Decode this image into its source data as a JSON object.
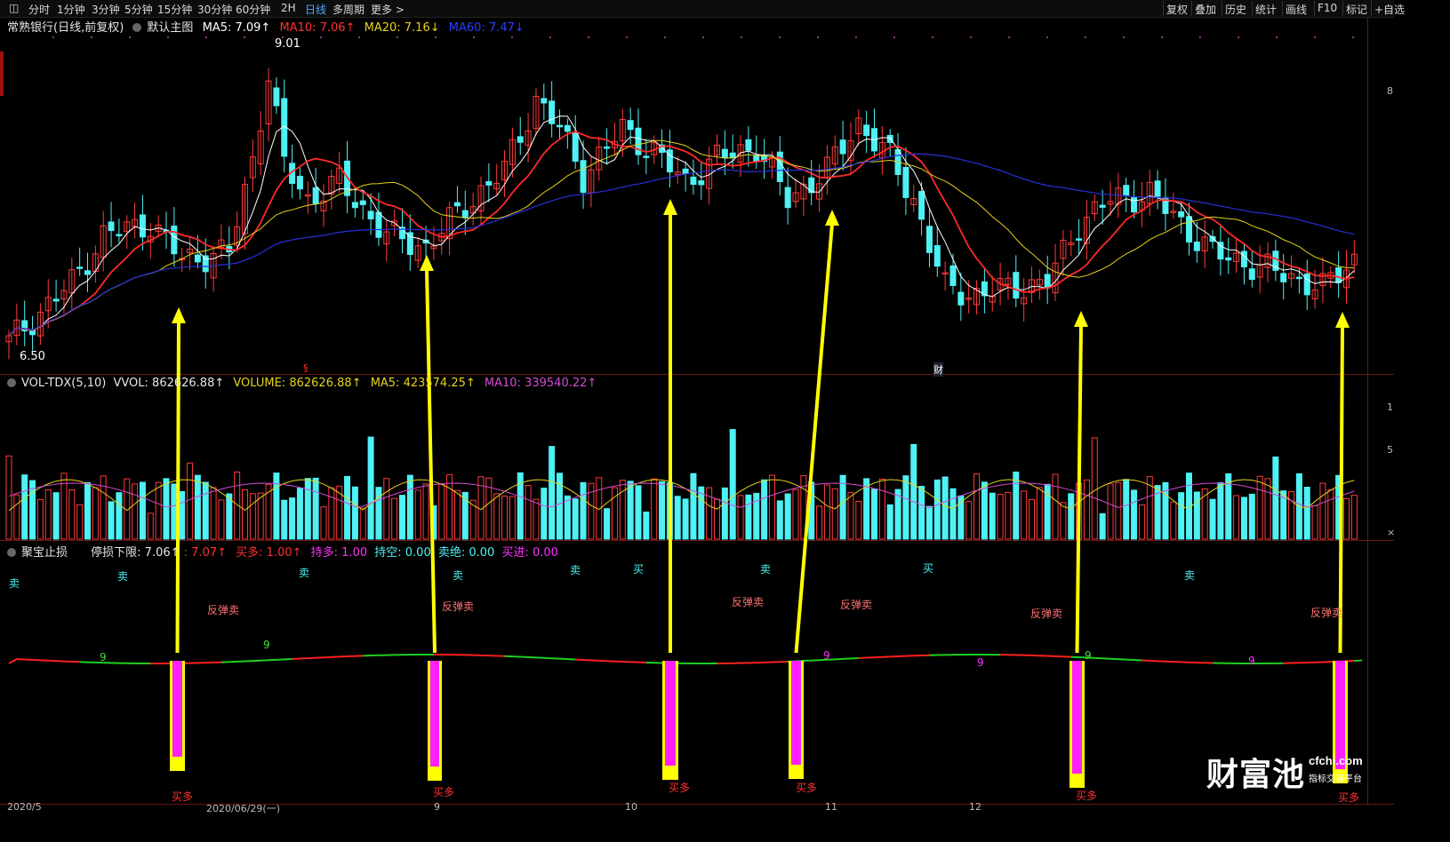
{
  "toolbar": {
    "periods": [
      "分时",
      "1分钟",
      "3分钟",
      "5分钟",
      "15分钟",
      "30分钟",
      "60分钟",
      "2H",
      "日线",
      "多周期",
      "更多 >"
    ],
    "active_period": "日线",
    "right_items": [
      "复权",
      "叠加",
      "历史",
      "统计",
      "画线",
      "F10",
      "标记",
      "+自选"
    ]
  },
  "main_panel": {
    "title": "常熟银行(日线,前复权)",
    "template": "默认主图",
    "ma5": "MA5: 7.09↑",
    "ma10": "MA10: 7.06↑",
    "ma20": "MA20: 7.16↓",
    "ma60": "MA60: 7.47↓",
    "high_label": "9.01",
    "low_label": "6.50",
    "cai_marker": "财",
    "s_marker": "§"
  },
  "volume_panel": {
    "name": "VOL-TDX(5,10)",
    "vvol": "VVOL: 862626.88↑",
    "volume": "VOLUME: 862626.88↑",
    "ma5": "MA5: 423574.25↑",
    "ma10": "MA10: 339540.22↑"
  },
  "indicator_panel": {
    "name": "聚宝止损",
    "stop_low": "停损下限: 7.06↑",
    "stop_low2": ": 7.07↑",
    "buy_more": "买多: 1.00↑",
    "hold_more": "持多: 1.00",
    "hold_empty": "持空: 0.00",
    "sell_out": "卖绝: 0.00",
    "buy_in": "买进: 0.00"
  },
  "signals": {
    "sell": "卖",
    "buy": "买",
    "rebound_sell": "反弹卖",
    "buy_more": "买多",
    "nine": "9"
  },
  "date_axis": [
    "2020/5",
    "2020/06/29(一)",
    "9",
    "10",
    "11",
    "12"
  ],
  "watermark": {
    "logo": "财富池",
    "site": "cfchi.com",
    "tag": "指标交易平台"
  },
  "colors": {
    "up": "#ff3b3b",
    "down": "#4ef1f4",
    "ma5": "#ffffff",
    "ma10": "#ff2a2a",
    "ma20": "#e6d21a",
    "ma60": "#2630d8",
    "arrow": "#ffff00",
    "bar": "#ff1fff"
  }
}
